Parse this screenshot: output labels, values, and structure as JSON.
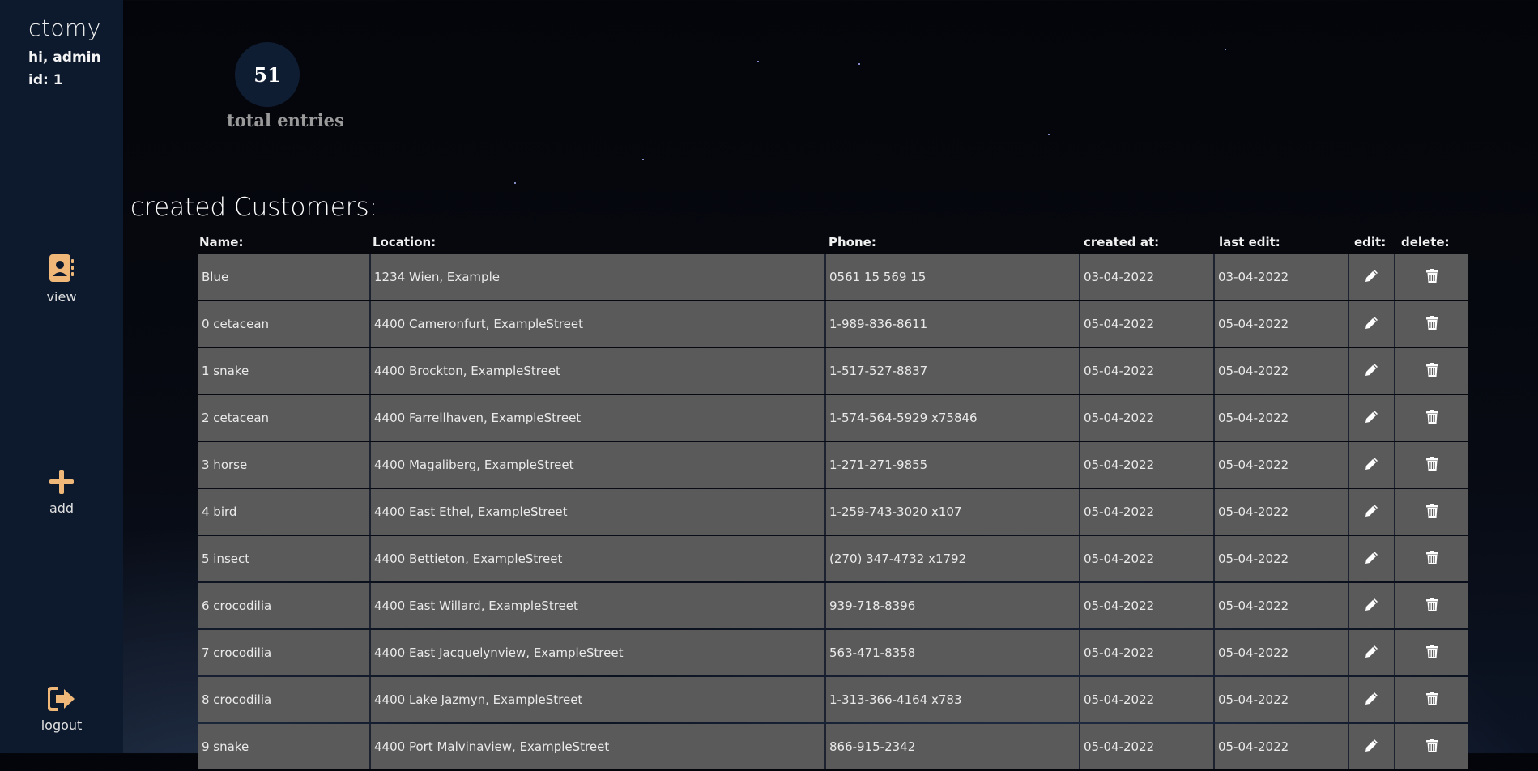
{
  "sidebar": {
    "brand": "ctomy",
    "greeting": "hi, admin",
    "user_id": "id: 1",
    "nav": {
      "view_label": "view",
      "add_label": "add",
      "logout_label": "logout"
    }
  },
  "stats": {
    "total": "51",
    "total_label": "total entries"
  },
  "section_title": "created Customers:",
  "table": {
    "headers": {
      "name": "Name:",
      "location": "Location:",
      "phone": "Phone:",
      "created": "created at:",
      "last_edit": "last edit:",
      "edit": "edit:",
      "delete": "delete:"
    },
    "rows": [
      {
        "name": "Blue",
        "location": "1234 Wien, Example",
        "phone": "0561 15 569 15",
        "created": "03-04-2022",
        "last_edit": "03-04-2022"
      },
      {
        "name": "0 cetacean",
        "location": "4400 Cameronfurt, ExampleStreet",
        "phone": "1-989-836-8611",
        "created": "05-04-2022",
        "last_edit": "05-04-2022"
      },
      {
        "name": "1 snake",
        "location": "4400 Brockton, ExampleStreet",
        "phone": "1-517-527-8837",
        "created": "05-04-2022",
        "last_edit": "05-04-2022"
      },
      {
        "name": "2 cetacean",
        "location": "4400 Farrellhaven, ExampleStreet",
        "phone": "1-574-564-5929 x75846",
        "created": "05-04-2022",
        "last_edit": "05-04-2022"
      },
      {
        "name": "3 horse",
        "location": "4400 Magaliberg, ExampleStreet",
        "phone": "1-271-271-9855",
        "created": "05-04-2022",
        "last_edit": "05-04-2022"
      },
      {
        "name": "4 bird",
        "location": "4400 East Ethel, ExampleStreet",
        "phone": "1-259-743-3020 x107",
        "created": "05-04-2022",
        "last_edit": "05-04-2022"
      },
      {
        "name": "5 insect",
        "location": "4400 Bettieton, ExampleStreet",
        "phone": "(270) 347-4732 x1792",
        "created": "05-04-2022",
        "last_edit": "05-04-2022"
      },
      {
        "name": "6 crocodilia",
        "location": "4400 East Willard, ExampleStreet",
        "phone": "939-718-8396",
        "created": "05-04-2022",
        "last_edit": "05-04-2022"
      },
      {
        "name": "7 crocodilia",
        "location": "4400 East Jacquelynview, ExampleStreet",
        "phone": "563-471-8358",
        "created": "05-04-2022",
        "last_edit": "05-04-2022"
      },
      {
        "name": "8 crocodilia",
        "location": "4400 Lake Jazmyn, ExampleStreet",
        "phone": "1-313-366-4164 x783",
        "created": "05-04-2022",
        "last_edit": "05-04-2022"
      },
      {
        "name": "9 snake",
        "location": "4400 Port Malvinaview, ExampleStreet",
        "phone": "866-915-2342",
        "created": "05-04-2022",
        "last_edit": "05-04-2022"
      }
    ]
  },
  "icons": {
    "view": "contact-book-icon",
    "add": "plus-icon",
    "logout": "logout-icon",
    "edit": "pencil-icon",
    "delete": "trash-icon"
  },
  "colors": {
    "sidebar_bg": "#0d1a2e",
    "accent": "#f0b878",
    "row_bg": "#5a5a5a"
  }
}
